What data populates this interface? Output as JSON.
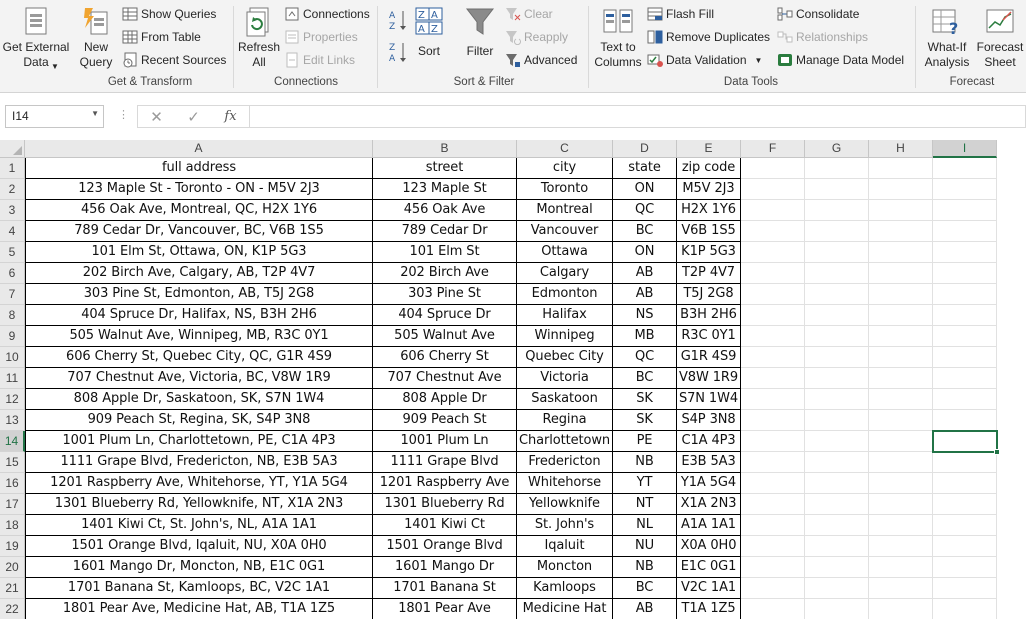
{
  "ribbon": {
    "get_transform": {
      "group_label": "Get & Transform",
      "get_external_data": "Get External\nData",
      "new_query": "New\nQuery",
      "show_queries": "Show Queries",
      "from_table": "From Table",
      "recent_sources": "Recent Sources"
    },
    "connections": {
      "group_label": "Connections",
      "refresh_all": "Refresh\nAll",
      "connections": "Connections",
      "properties": "Properties",
      "edit_links": "Edit Links"
    },
    "sort_filter": {
      "group_label": "Sort & Filter",
      "sort": "Sort",
      "filter": "Filter",
      "clear": "Clear",
      "reapply": "Reapply",
      "advanced": "Advanced"
    },
    "data_tools": {
      "group_label": "Data Tools",
      "text_to_columns": "Text to\nColumns",
      "flash_fill": "Flash Fill",
      "remove_duplicates": "Remove Duplicates",
      "data_validation": "Data Validation",
      "consolidate": "Consolidate",
      "relationships": "Relationships",
      "manage_data_model": "Manage Data Model"
    },
    "forecast": {
      "group_label": "Forecast",
      "what_if": "What-If\nAnalysis",
      "forecast_sheet": "Forecast\nSheet"
    }
  },
  "formula_bar": {
    "name_box": "I14",
    "formula": ""
  },
  "sheet": {
    "columns": [
      "A",
      "B",
      "C",
      "D",
      "E",
      "F",
      "G",
      "H",
      "I"
    ],
    "selected_column": "I",
    "selected_row": 14,
    "headers": [
      "full address",
      "street",
      "city",
      "state",
      "zip code"
    ],
    "rows": [
      [
        "123 Maple St - Toronto - ON - M5V 2J3",
        "123 Maple St",
        "Toronto",
        "ON",
        "M5V 2J3"
      ],
      [
        "456 Oak Ave, Montreal, QC, H2X 1Y6",
        "456 Oak Ave",
        "Montreal",
        "QC",
        "H2X 1Y6"
      ],
      [
        "789 Cedar Dr, Vancouver, BC, V6B 1S5",
        "789 Cedar Dr",
        "Vancouver",
        "BC",
        "V6B 1S5"
      ],
      [
        "101 Elm St, Ottawa, ON, K1P 5G3",
        "101 Elm St",
        "Ottawa",
        "ON",
        "K1P 5G3"
      ],
      [
        "202 Birch Ave, Calgary, AB, T2P 4V7",
        "202 Birch Ave",
        "Calgary",
        "AB",
        "T2P 4V7"
      ],
      [
        "303 Pine St, Edmonton, AB, T5J 2G8",
        "303 Pine St",
        "Edmonton",
        "AB",
        "T5J 2G8"
      ],
      [
        "404 Spruce Dr, Halifax, NS, B3H 2H6",
        "404 Spruce Dr",
        "Halifax",
        "NS",
        "B3H 2H6"
      ],
      [
        "505 Walnut Ave, Winnipeg, MB, R3C 0Y1",
        "505 Walnut Ave",
        "Winnipeg",
        "MB",
        "R3C 0Y1"
      ],
      [
        "606 Cherry St, Quebec City, QC, G1R 4S9",
        "606 Cherry St",
        "Quebec City",
        "QC",
        "G1R 4S9"
      ],
      [
        "707 Chestnut Ave, Victoria, BC, V8W 1R9",
        "707 Chestnut Ave",
        "Victoria",
        "BC",
        "V8W 1R9"
      ],
      [
        "808 Apple Dr, Saskatoon, SK, S7N 1W4",
        "808 Apple Dr",
        "Saskatoon",
        "SK",
        "S7N 1W4"
      ],
      [
        "909 Peach St, Regina, SK, S4P 3N8",
        "909 Peach St",
        "Regina",
        "SK",
        "S4P 3N8"
      ],
      [
        "1001 Plum Ln, Charlottetown, PE, C1A 4P3",
        "1001 Plum Ln",
        "Charlottetown",
        "PE",
        "C1A 4P3"
      ],
      [
        "1111 Grape Blvd, Fredericton, NB, E3B 5A3",
        "1111 Grape Blvd",
        "Fredericton",
        "NB",
        "E3B 5A3"
      ],
      [
        "1201 Raspberry Ave, Whitehorse, YT, Y1A 5G4",
        "1201 Raspberry Ave",
        "Whitehorse",
        "YT",
        "Y1A 5G4"
      ],
      [
        "1301 Blueberry Rd, Yellowknife, NT, X1A 2N3",
        "1301 Blueberry Rd",
        "Yellowknife",
        "NT",
        "X1A 2N3"
      ],
      [
        "1401 Kiwi Ct, St. John's, NL, A1A 1A1",
        "1401 Kiwi Ct",
        "St. John's",
        "NL",
        "A1A 1A1"
      ],
      [
        "1501 Orange Blvd, Iqaluit, NU, X0A 0H0",
        "1501 Orange Blvd",
        "Iqaluit",
        "NU",
        "X0A 0H0"
      ],
      [
        "1601 Mango Dr, Moncton, NB, E1C 0G1",
        "1601 Mango Dr",
        "Moncton",
        "NB",
        "E1C 0G1"
      ],
      [
        "1701 Banana St, Kamloops, BC, V2C 1A1",
        "1701 Banana St",
        "Kamloops",
        "BC",
        "V2C 1A1"
      ],
      [
        "1801 Pear Ave, Medicine Hat, AB, T1A 1Z5",
        "1801 Pear Ave",
        "Medicine Hat",
        "AB",
        "T1A 1Z5"
      ]
    ]
  },
  "colors": {
    "accent": "#217346",
    "ribbon_bg": "#f3f3f3",
    "header_bg": "#e9e9e9"
  }
}
